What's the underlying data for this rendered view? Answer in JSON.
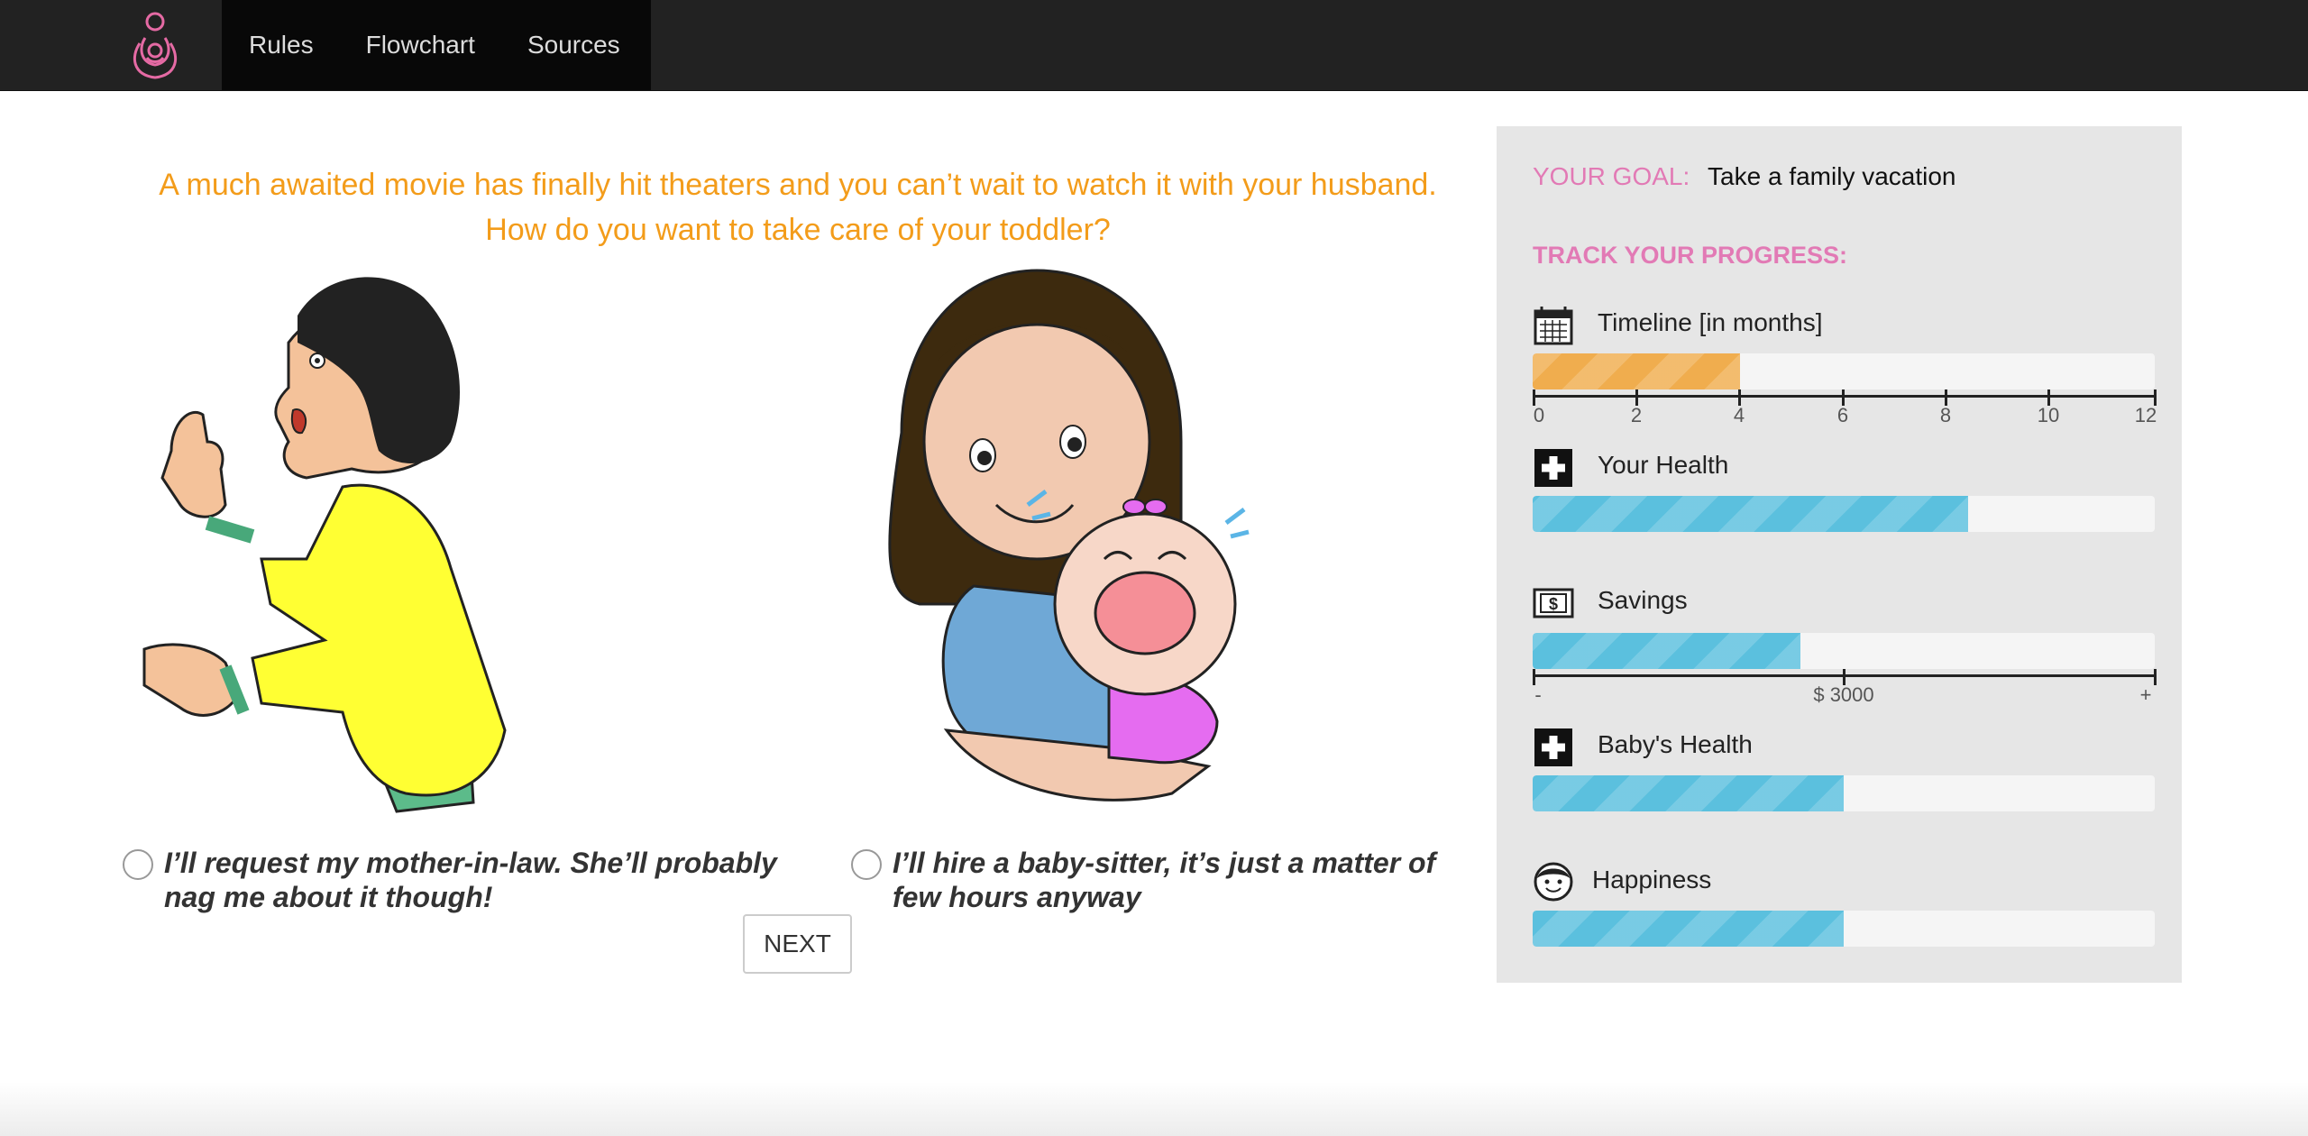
{
  "nav": {
    "logo_icon": "mother-baby-logo-icon",
    "links": [
      "Rules",
      "Flowchart",
      "Sources"
    ]
  },
  "question": {
    "text": "A much awaited movie has finally hit theaters and you can’t wait to watch it with your husband. How do you want to take care of your toddler?"
  },
  "options": [
    {
      "text": "I’ll request my mother-in-law. She’ll probably nag me about it though!",
      "selected": false
    },
    {
      "text": "I’ll hire a baby-sitter, it’s just a matter of few hours anyway",
      "selected": false
    }
  ],
  "next_label": "NEXT",
  "panel": {
    "goal_label": "YOUR GOAL:",
    "goal_value": "Take a family vacation",
    "track_label": "TRACK YOUR PROGRESS:",
    "metrics": [
      {
        "label": "Timeline [in months]",
        "icon": "calendar-icon",
        "value": 4,
        "max": 12,
        "color": "#f0ad4e",
        "axis_ticks": [
          "0",
          "2",
          "4",
          "6",
          "8",
          "10",
          "12"
        ]
      },
      {
        "label": "Your Health",
        "icon": "health-cross-icon",
        "fraction": 0.7,
        "color": "#5bc0de"
      },
      {
        "label": "Savings",
        "icon": "dollar-icon",
        "fraction": 0.43,
        "color": "#5bc0de",
        "axis_labels": {
          "min": "-",
          "mid": "$ 3000",
          "max": "+"
        }
      },
      {
        "label": "Baby's Health",
        "icon": "health-cross-icon",
        "fraction": 0.5,
        "color": "#5bc0de"
      },
      {
        "label": "Happiness",
        "icon": "smiley-face-icon",
        "fraction": 0.5,
        "color": "#5bc0de"
      }
    ]
  },
  "colors": {
    "question": "#f39c1a",
    "goal_accent": "#e27ab5",
    "navbar": "#222222"
  }
}
